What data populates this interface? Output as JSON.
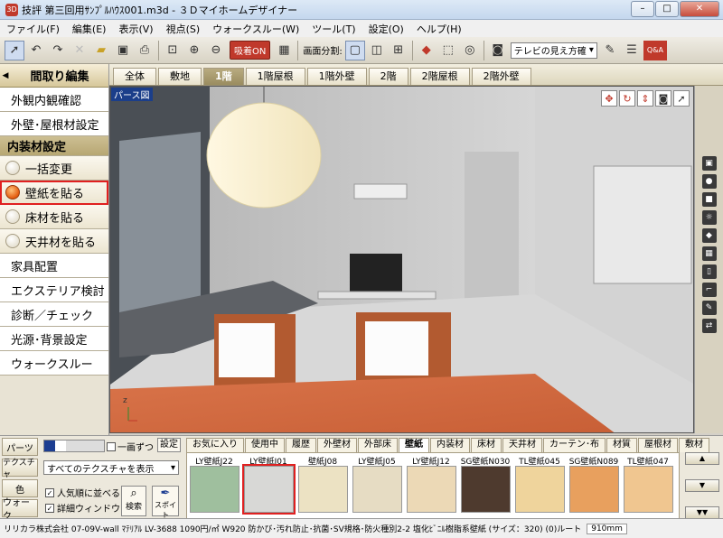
{
  "window": {
    "title": "技評 第三回用ｻﾝﾌﾟﾙﾊｳｽ001.m3d - ３Ｄマイホームデザイナー",
    "app_icon": "3D",
    "min": "–",
    "max": "□",
    "close": "✕"
  },
  "menu": [
    "ファイル(F)",
    "編集(E)",
    "表示(V)",
    "視点(S)",
    "ウォークスルー(W)",
    "ツール(T)",
    "設定(O)",
    "ヘルプ(H)"
  ],
  "toolbar": {
    "snap_label": "吸着ON",
    "split_label": "画面分割:",
    "tv_view_label": "テレビの見え方確",
    "qa_label": "Q&A"
  },
  "sidebar": {
    "header": "間取り編集",
    "items": [
      {
        "label": "外観内観確認",
        "kind": "item"
      },
      {
        "label": "外壁･屋根材設定",
        "kind": "item"
      },
      {
        "label": "内装材設定",
        "kind": "section"
      },
      {
        "label": "一括変更",
        "kind": "sub",
        "on": false
      },
      {
        "label": "壁紙を貼る",
        "kind": "sub",
        "on": true
      },
      {
        "label": "床材を貼る",
        "kind": "sub",
        "on": false
      },
      {
        "label": "天井材を貼る",
        "kind": "sub",
        "on": false
      },
      {
        "label": "家具配置",
        "kind": "item"
      },
      {
        "label": "エクステリア検討",
        "kind": "item"
      },
      {
        "label": "診断／チェック",
        "kind": "item"
      },
      {
        "label": "光源･背景設定",
        "kind": "item"
      },
      {
        "label": "ウォークスルー",
        "kind": "item"
      }
    ]
  },
  "view_tabs": [
    {
      "label": "全体",
      "active": false
    },
    {
      "label": "敷地",
      "active": false
    },
    {
      "label": "1階",
      "active": true
    },
    {
      "label": "1階屋根",
      "active": false
    },
    {
      "label": "1階外壁",
      "active": false
    },
    {
      "label": "2階",
      "active": false
    },
    {
      "label": "2階屋根",
      "active": false
    },
    {
      "label": "2階外壁",
      "active": false
    }
  ],
  "viewport": {
    "label": "パース図"
  },
  "bottom": {
    "tab_parts": "パーツ",
    "tab_texture": "テクスチャ",
    "tab_color": "色",
    "tab_walk": "ウォーク",
    "one_screen": "一画ずつ",
    "setting": "設定",
    "texture_filter": "すべてのテクスチャを表示",
    "sort_popular": "人気順に並べる",
    "detail_window": "詳細ウィンドウ",
    "search": "検索",
    "spoit": "スポイト",
    "categories": [
      {
        "label": "お気に入り",
        "active": false
      },
      {
        "label": "使用中",
        "active": false
      },
      {
        "label": "履歴",
        "active": false
      },
      {
        "label": "外壁材",
        "active": false
      },
      {
        "label": "外部床",
        "active": false
      },
      {
        "label": "壁紙",
        "active": true
      },
      {
        "label": "内装材",
        "active": false
      },
      {
        "label": "床材",
        "active": false
      },
      {
        "label": "天井材",
        "active": false
      },
      {
        "label": "カーテン･布",
        "active": false
      },
      {
        "label": "材質",
        "active": false
      },
      {
        "label": "屋根材",
        "active": false
      },
      {
        "label": "敷材",
        "active": false
      }
    ],
    "swatches": [
      {
        "name": "LY壁紙J22",
        "color": "#9fbf9e",
        "selected": false
      },
      {
        "name": "LY壁紙J01",
        "color": "#d8d8d6",
        "selected": true
      },
      {
        "name": "壁紙J08",
        "color": "#ece2c3",
        "selected": false
      },
      {
        "name": "LY壁紙J05",
        "color": "#e6dcc3",
        "selected": false
      },
      {
        "name": "LY壁紙J12",
        "color": "#ecd9b6",
        "selected": false
      },
      {
        "name": "SG壁紙N030",
        "color": "#4e3a2e",
        "selected": false
      },
      {
        "name": "TL壁紙045",
        "color": "#efd49c",
        "selected": false
      },
      {
        "name": "SG壁紙N089",
        "color": "#e8a05e",
        "selected": false
      },
      {
        "name": "TL壁紙047",
        "color": "#f0c690",
        "selected": false
      }
    ]
  },
  "status": {
    "text": "リリカラ株式会社 07-09V-wall ﾏﾃﾘｱﾙ LV-3688 1090円/㎡ W920 防かび･汚れ防止･抗菌･SV規格･防火種別2-2 塩化ﾋﾞﾆﾙ樹脂系壁紙 (サイズ：320) (0)ルート",
    "size": "910mm"
  }
}
